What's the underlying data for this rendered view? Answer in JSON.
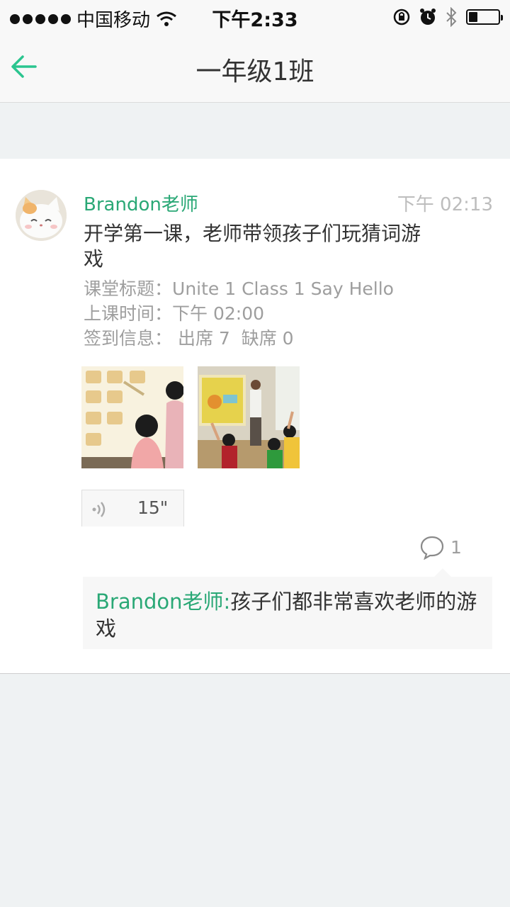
{
  "status_bar": {
    "carrier": "中国移动",
    "time": "下午2:33",
    "battery_level": 0.3
  },
  "nav": {
    "title": "一年级1班",
    "back_icon": "arrow-left-icon",
    "accent_color": "#2bc58f"
  },
  "post": {
    "author": "Brandon老师",
    "time": "下午 02:13",
    "text": "开学第一课，老师带领孩子们玩猜词游戏",
    "class_title_label": "课堂标题：",
    "class_title": "Unite 1 Class 1 Say Hello",
    "class_time_label": "上课时间：",
    "class_time": "下午 02:00",
    "signin_label": "签到信息：",
    "signin": " 出席 7  缺席 0",
    "voice_duration": "15\"",
    "comment_count": "1",
    "author_color": "#2aa876"
  },
  "comments": [
    {
      "author": "Brandon老师:",
      "text": "孩子们都非常喜欢老师的游戏"
    }
  ]
}
